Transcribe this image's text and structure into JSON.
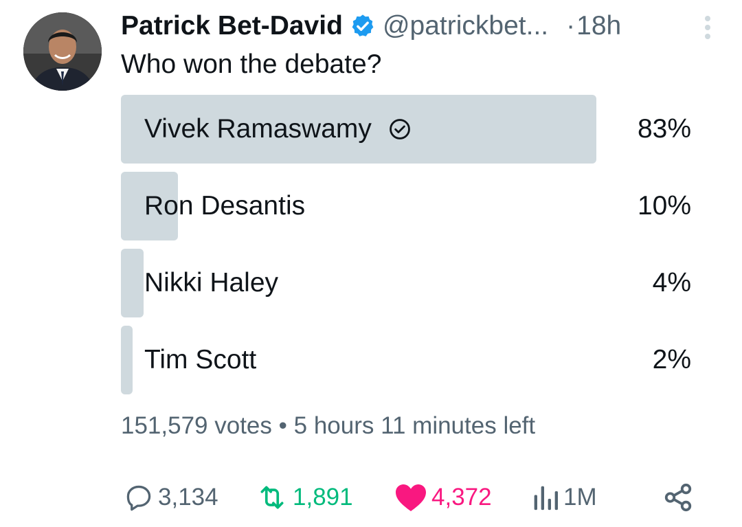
{
  "author": {
    "name": "Patrick Bet-David",
    "handle": "@patrickbet...",
    "time": "18h",
    "avatar_icon": "avatar-photo",
    "verified_color": "#1d9bf0"
  },
  "tweet": {
    "text": "Who won the debate?"
  },
  "poll": {
    "options": [
      {
        "label": "Vivek Ramaswamy",
        "percent_label": "83%",
        "percent": 83,
        "chosen": true
      },
      {
        "label": "Ron Desantis",
        "percent_label": "10%",
        "percent": 10,
        "chosen": false
      },
      {
        "label": "Nikki Haley",
        "percent_label": "4%",
        "percent": 4,
        "chosen": false
      },
      {
        "label": "Tim Scott",
        "percent_label": "2%",
        "percent": 2,
        "chosen": false
      }
    ],
    "votes": "151,579 votes",
    "separator": "•",
    "time_left": "5 hours 11 minutes left",
    "bar_color": "#cfd9de"
  },
  "actions": {
    "replies": "3,134",
    "reposts": "1,891",
    "likes": "4,372",
    "views": "1M",
    "repost_color": "#00ba7c",
    "like_color": "#f91880",
    "muted_color": "#536471"
  }
}
